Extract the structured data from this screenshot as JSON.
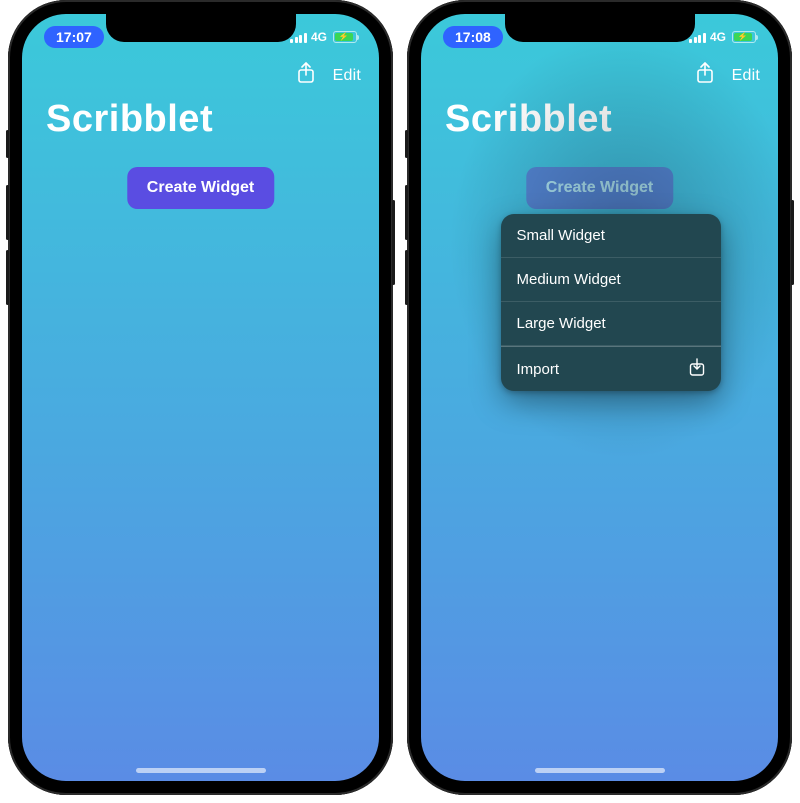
{
  "left": {
    "status": {
      "time": "17:07",
      "network": "4G"
    },
    "nav": {
      "edit": "Edit"
    },
    "title": "Scribblet",
    "create_label": "Create Widget"
  },
  "right": {
    "status": {
      "time": "17:08",
      "network": "4G"
    },
    "nav": {
      "edit": "Edit"
    },
    "title": "Scribblet",
    "create_label": "Create Widget",
    "menu": {
      "small": "Small Widget",
      "medium": "Medium Widget",
      "large": "Large Widget",
      "import": "Import"
    }
  }
}
